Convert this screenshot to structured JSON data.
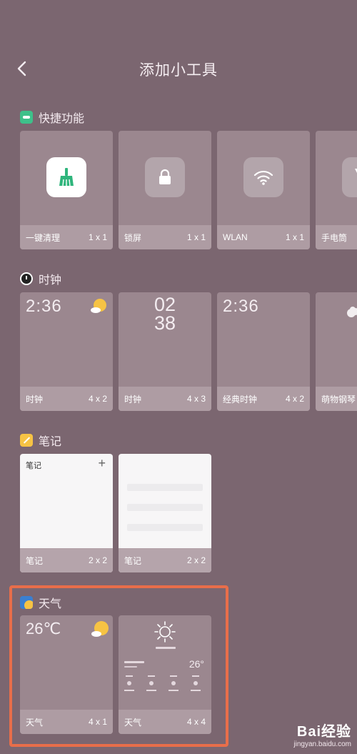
{
  "header": {
    "title": "添加小工具"
  },
  "sections": {
    "quick": {
      "label": "快捷功能",
      "items": [
        {
          "name": "一键清理",
          "size": "1 x 1"
        },
        {
          "name": "锁屏",
          "size": "1 x 1"
        },
        {
          "name": "WLAN",
          "size": "1 x 1"
        },
        {
          "name": "手电筒",
          "size": ""
        }
      ]
    },
    "clock": {
      "label": "时钟",
      "items": [
        {
          "name": "时钟",
          "size": "4 x 2",
          "time": "2:36"
        },
        {
          "name": "时钟",
          "size": "4 x 3",
          "hour": "02",
          "minute": "38"
        },
        {
          "name": "经典时钟",
          "size": "4 x 2",
          "time": "2:36"
        },
        {
          "name": "萌物钢琴",
          "size": ""
        }
      ]
    },
    "notes": {
      "label": "笔记",
      "items": [
        {
          "name": "笔记",
          "size": "2 x 2",
          "title": "笔记",
          "plus": "+"
        },
        {
          "name": "笔记",
          "size": "2 x 2"
        }
      ]
    },
    "weather": {
      "label": "天气",
      "items": [
        {
          "name": "天气",
          "size": "4 x 1",
          "temp": "26℃"
        },
        {
          "name": "天气",
          "size": "4 x 4",
          "temp": "26°"
        }
      ]
    }
  },
  "watermark": {
    "brand": "Bai经验",
    "url": "jingyan.baidu.com"
  },
  "colors": {
    "highlight": "#e86e4a",
    "background": "#7b6670",
    "quick_icon": "#3ec08a"
  },
  "icons": [
    "back-arrow-icon",
    "broom-icon",
    "lock-icon",
    "wifi-icon",
    "flashlight-icon",
    "clock-icon",
    "note-icon",
    "weather-icon",
    "sun-icon"
  ]
}
